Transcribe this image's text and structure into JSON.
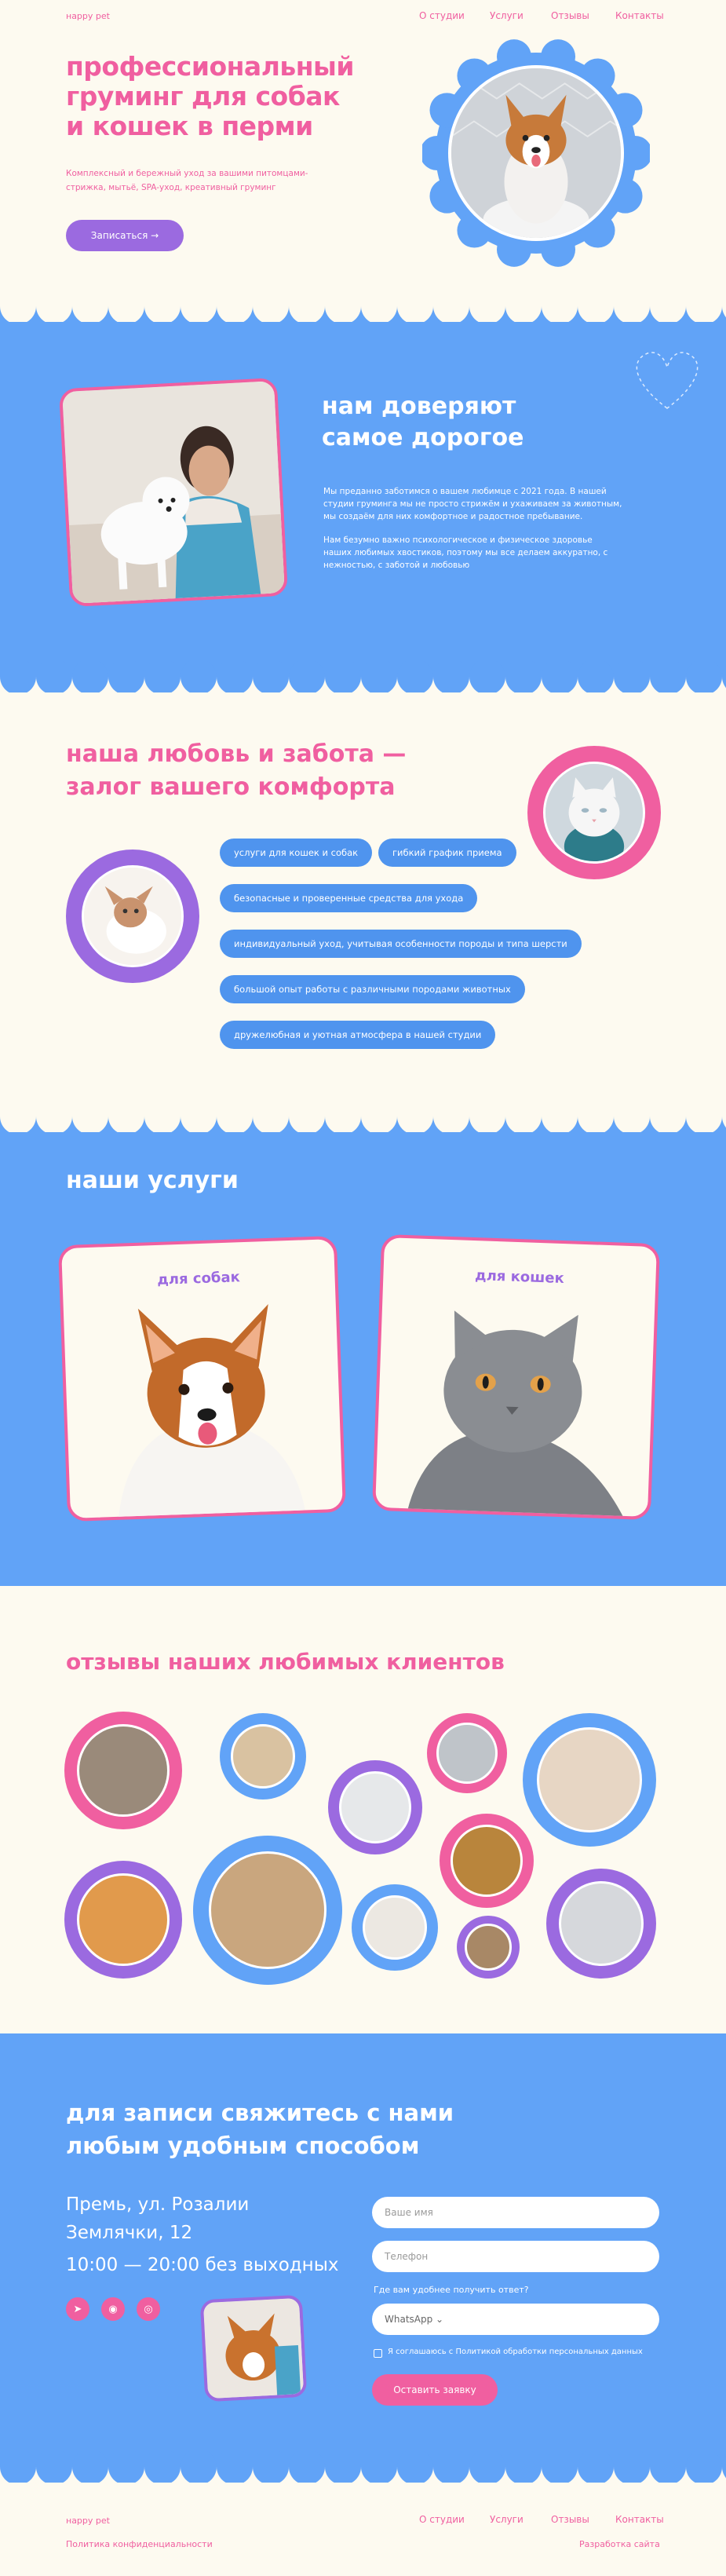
{
  "header": {
    "logo": "нappy pet",
    "nav": [
      "О студии",
      "Услуги",
      "Отзывы",
      "Контакты"
    ]
  },
  "hero": {
    "title_line1": "профессиональный",
    "title_line2": "груминг для собак",
    "title_line3": "и кошек в перми",
    "subtitle_line1": "Комплексный и бережный уход за вашими питомцами-",
    "subtitle_line2": "стрижка, мытьё, SPA-уход, креативный груминг",
    "cta": "Записаться →"
  },
  "trust": {
    "title_line1": "нам доверяют",
    "title_line2": "самое дорогое",
    "p1_line1": "Мы преданно заботимся о вашем любимце с 2021 года. В нашей",
    "p1_line2": "студии груминга мы не просто стрижём и ухаживаем за животным,",
    "p1_line3": "мы создаём для них комфортное и радостное пребывание.",
    "p2_line1": "Нам безумно важно психологическое и физическое здоровье",
    "p2_line2": "наших любимых хвостиков, поэтому мы все делаем аккуратно, с",
    "p2_line3": "нежностью, с заботой и любовью"
  },
  "care": {
    "title_line1": "наша любовь и забота —",
    "title_line2": "залог вашего комфорта",
    "tags": [
      "услуги для кошек и собак",
      "гибкий график приема",
      "безопасные и проверенные средства для ухода",
      "индивидуальный уход, учитывая особенности породы и типа шерсти",
      "большой опыт работы с различными породами животных",
      "дружелюбная и уютная атмосфера в нашей студии"
    ]
  },
  "services": {
    "title": "наши услуги",
    "dogs": "для собак",
    "cats": "для кошек"
  },
  "reviews": {
    "title": "отзывы наших любимых клиентов"
  },
  "contact": {
    "title_line1": "для записи свяжитесь с нами",
    "title_line2": "любым удобным способом",
    "address_line1": "Премь, ул. Розалии",
    "address_line2": "Землячки, 12",
    "hours": "10:00 — 20:00 без выходных",
    "name_placeholder": "Ваше имя",
    "phone_placeholder": "Телефон",
    "question": "Где вам удобнее получить ответ?",
    "select_value": "WhatsApp ⌄",
    "consent": "Я соглашаюсь с Политикой обработки персональных данных",
    "submit": "Оставить заявку"
  },
  "footer": {
    "logo": "нappy pet",
    "nav": [
      "О студии",
      "Услуги",
      "Отзывы",
      "Контакты"
    ],
    "policy": "Политика конфиденциальности",
    "dev": "Разработка сайта"
  },
  "colors": {
    "blue": "#61a3f7",
    "pink": "#f05fa0",
    "purple": "#9b6ae0",
    "cream": "#fdfaf0"
  }
}
